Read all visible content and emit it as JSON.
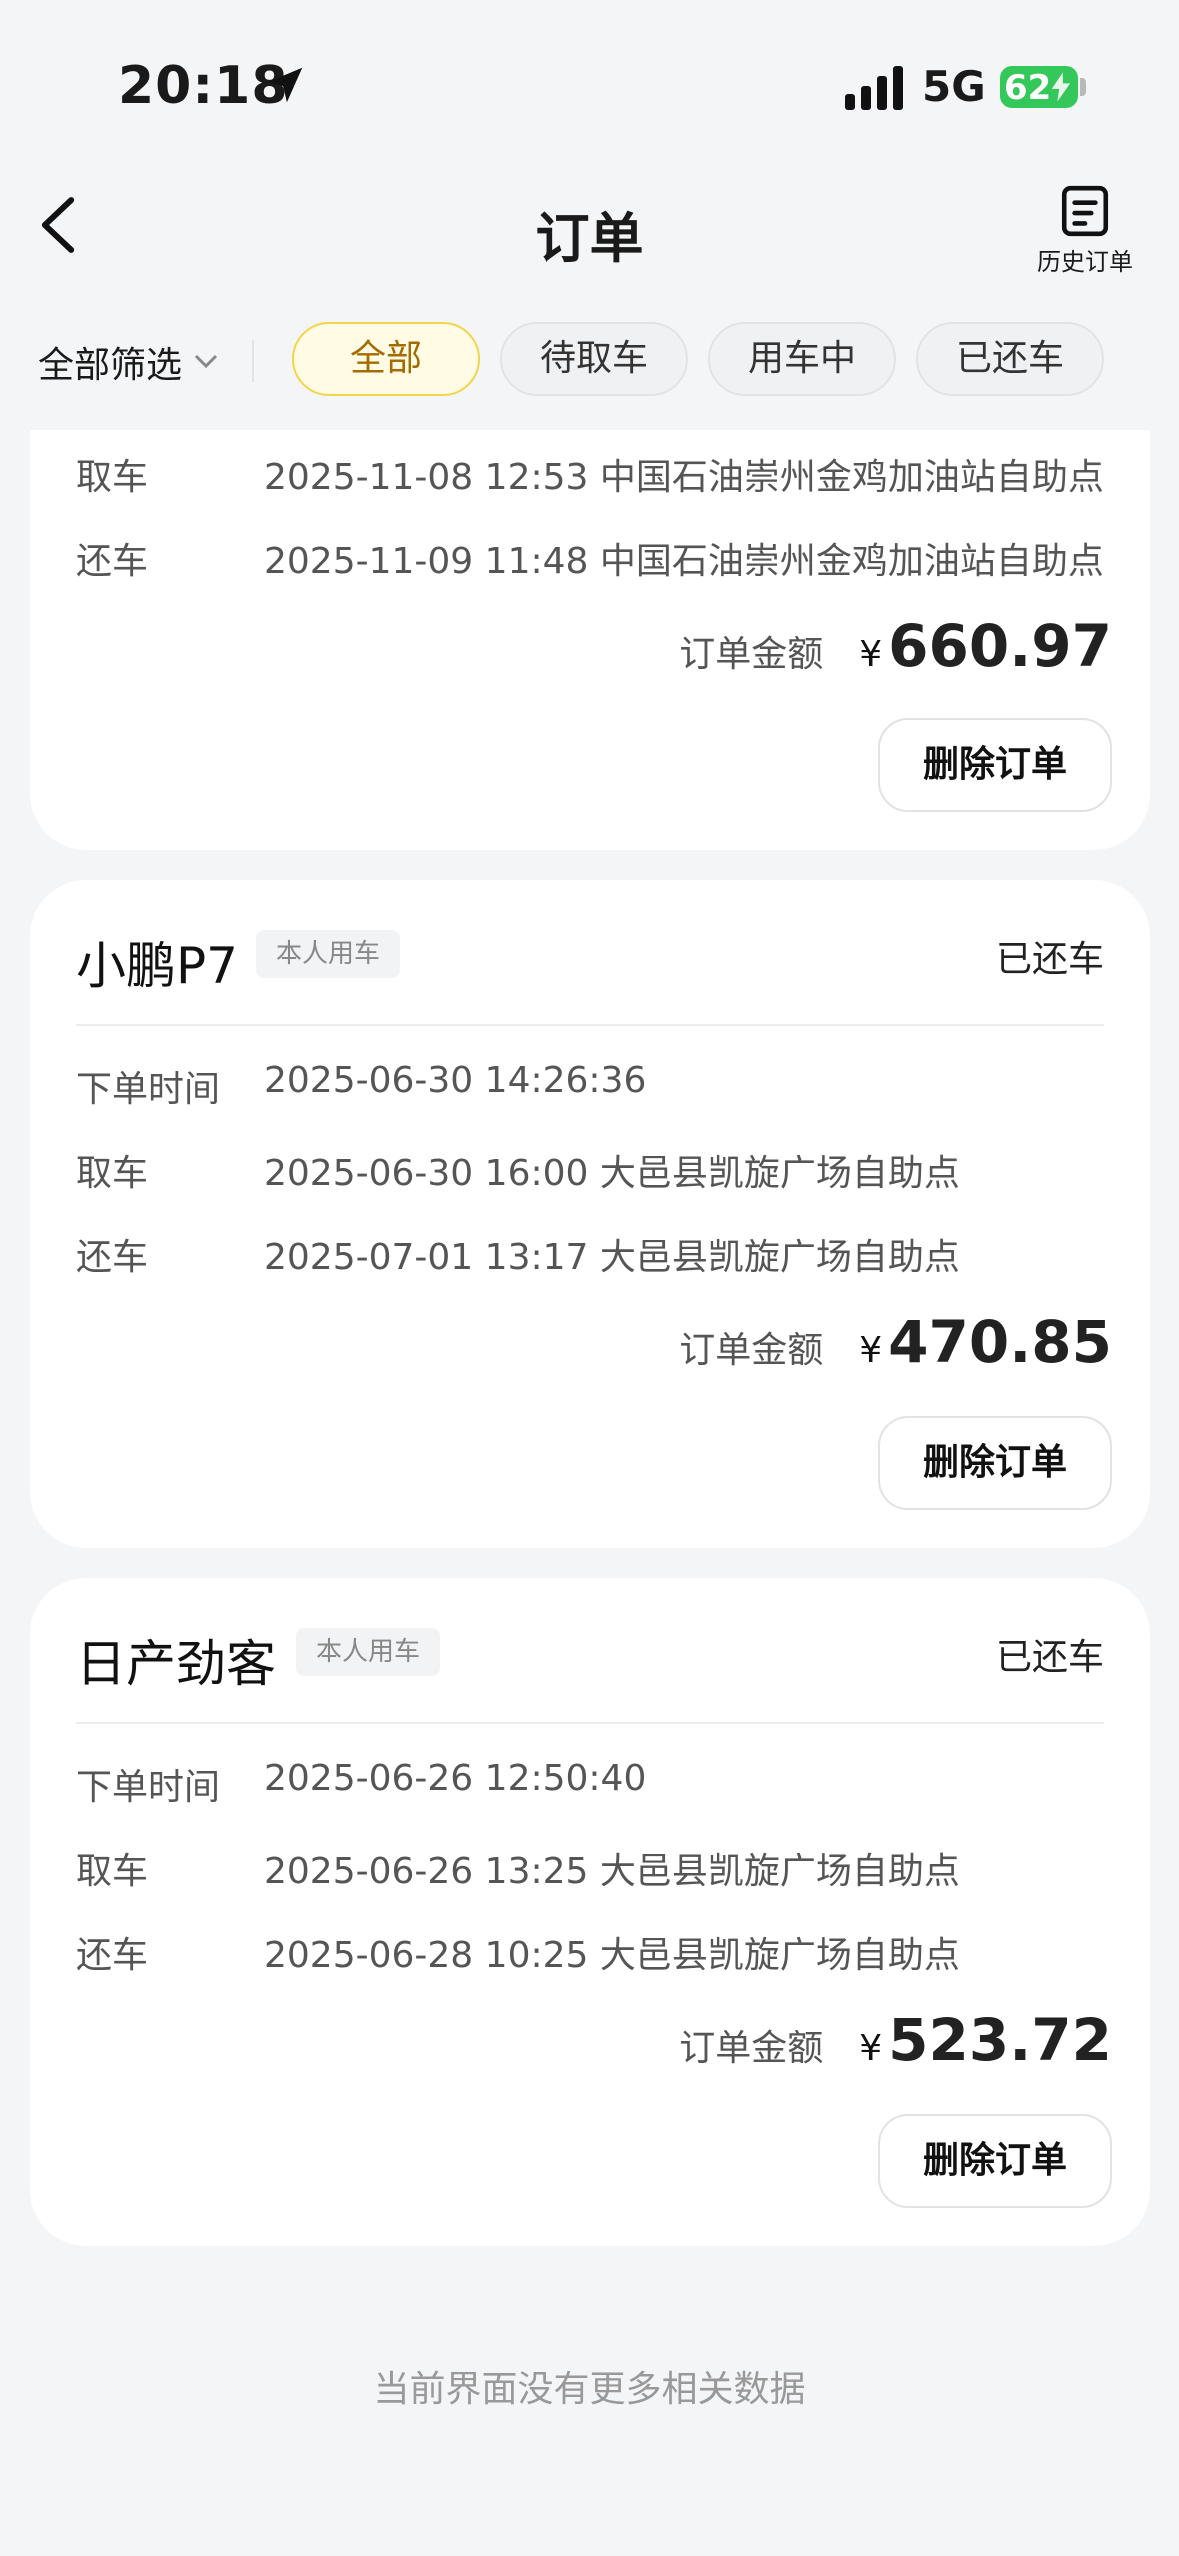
{
  "status_bar": {
    "time": "20:18",
    "network": "5G",
    "battery": "62"
  },
  "nav": {
    "title": "订单",
    "history_label": "历史订单"
  },
  "filters": {
    "all_filter": "全部筛选",
    "chips": [
      "全部",
      "待取车",
      "用车中",
      "已还车"
    ],
    "active_chip": "全部"
  },
  "orders": [
    {
      "pickup_label": "取车",
      "pickup": "2025-11-08 12:53 中国石油崇州金鸡加油站自助点",
      "return_label": "还车",
      "return": "2025-11-09 11:48 中国石油崇州金鸡加油站自助点",
      "amount_label": "订单金额",
      "currency": "¥",
      "amount": "660.97",
      "delete_label": "删除订单"
    },
    {
      "car": "小鹏P7",
      "tag": "本人用车",
      "status": "已还车",
      "order_time_label": "下单时间",
      "order_time": "2025-06-30 14:26:36",
      "pickup_label": "取车",
      "pickup": "2025-06-30 16:00 大邑县凯旋广场自助点",
      "return_label": "还车",
      "return": "2025-07-01 13:17 大邑县凯旋广场自助点",
      "amount_label": "订单金额",
      "currency": "¥",
      "amount": "470.85",
      "delete_label": "删除订单"
    },
    {
      "car": "日产劲客",
      "tag": "本人用车",
      "status": "已还车",
      "order_time_label": "下单时间",
      "order_time": "2025-06-26 12:50:40",
      "pickup_label": "取车",
      "pickup": "2025-06-26 13:25 大邑县凯旋广场自助点",
      "return_label": "还车",
      "return": "2025-06-28 10:25 大邑县凯旋广场自助点",
      "amount_label": "订单金额",
      "currency": "¥",
      "amount": "523.72",
      "delete_label": "删除订单"
    }
  ],
  "footer": {
    "no_more": "当前界面没有更多相关数据"
  },
  "colors": {
    "accent": "#f2d54b",
    "accent_text": "#a46c00",
    "battery": "#34c759"
  }
}
